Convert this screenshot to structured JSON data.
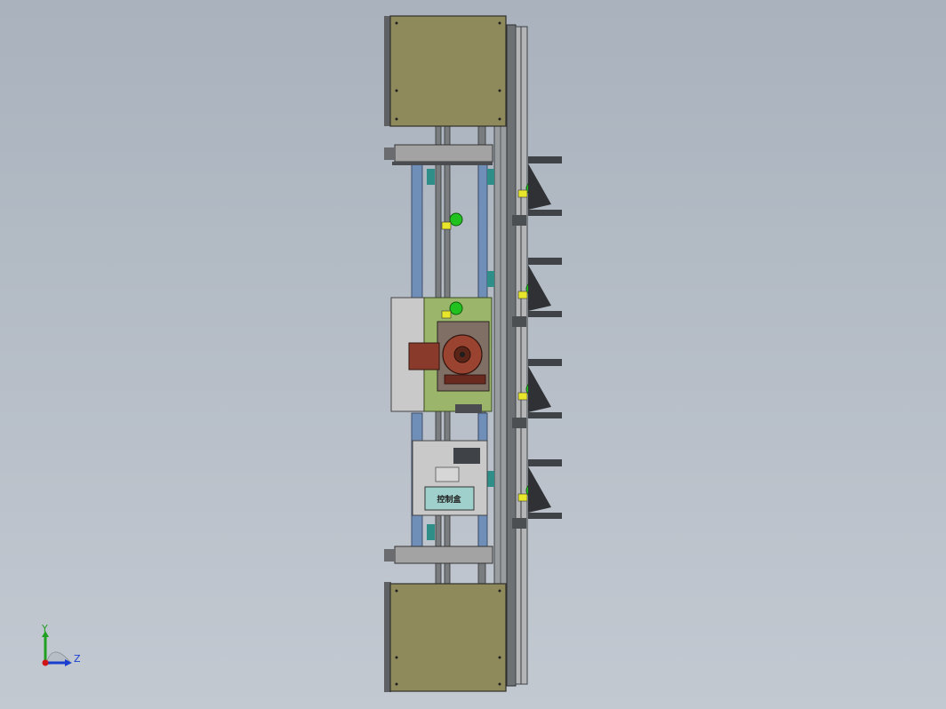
{
  "colors": {
    "background_top": "#a9b2bd",
    "background_bottom": "#c3c9d1",
    "enclosure": "#8f8a5c",
    "frame_gray": "#8a8d90",
    "dark_steel": "#3f4246",
    "rail_blue": "#6f8fb8",
    "teal_block": "#2f8f88",
    "green_plate": "#9bb56a",
    "motor_red": "#8a3a2a",
    "control_panel": "#c9c9c9",
    "screen_teal": "#9fd0cc",
    "pointer_green": "#21c11f",
    "pointer_yellow": "#e8e62a",
    "triad_x": "#d01414",
    "triad_y": "#20a020",
    "triad_z": "#1a3fd0"
  },
  "control_panel": {
    "screen_label": "控制盒"
  },
  "triad": {
    "y_label": "Y",
    "z_label": "Z",
    "icon": "coordinate-triad-icon"
  }
}
